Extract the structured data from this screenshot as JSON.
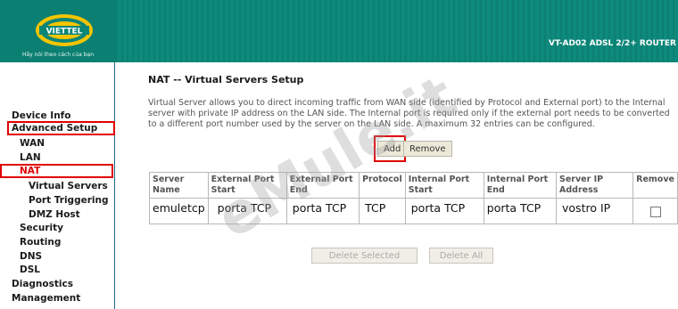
{
  "header": {
    "brand": "VIETTEL",
    "tagline": "Hãy nói theo cách của bạn",
    "model": "VT-AD02 ADSL 2/2+ ROUTER"
  },
  "sidebar": {
    "items": [
      {
        "label": "Device Info",
        "highlight": false
      },
      {
        "label": "Advanced Setup",
        "highlight": true
      },
      {
        "label": "WAN",
        "highlight": false
      },
      {
        "label": "LAN",
        "highlight": false
      },
      {
        "label": "NAT",
        "highlight": true
      },
      {
        "label": "Virtual Servers",
        "highlight": false
      },
      {
        "label": "Port Triggering",
        "highlight": false
      },
      {
        "label": "DMZ Host",
        "highlight": false
      },
      {
        "label": "Security",
        "highlight": false
      },
      {
        "label": "Routing",
        "highlight": false
      },
      {
        "label": "DNS",
        "highlight": false
      },
      {
        "label": "DSL",
        "highlight": false
      },
      {
        "label": "Diagnostics",
        "highlight": false
      },
      {
        "label": "Management",
        "highlight": false
      }
    ]
  },
  "main": {
    "title": "NAT -- Virtual Servers Setup",
    "description": "Virtual Server allows you to direct incoming traffic from WAN side (identified by Protocol and External port) to the Internal server with private IP address on the LAN side. The Internal port is required only if the external port needs to be converted to a different port number used by the server on the LAN side. A maximum 32 entries can be configured.",
    "add_label": "Add",
    "remove_label": "Remove",
    "table": {
      "headers": [
        "Server Name",
        "External Port Start",
        "External Port End",
        "Protocol",
        "Internal Port Start",
        "Internal Port End",
        "Server IP Address",
        "Remove"
      ],
      "rows": [
        [
          "emuletcp",
          "porta TCP",
          "porta TCP",
          "TCP",
          "porta TCP",
          "porta TCP",
          "vostro IP",
          ""
        ]
      ]
    },
    "delete_selected_label": "Delete Selected",
    "delete_all_label": "Delete All"
  },
  "watermark": "eMule.it",
  "colors": {
    "header_bg": "#0c8577",
    "highlight_box": "#e00000",
    "nav_text": "#1b1b1b"
  }
}
